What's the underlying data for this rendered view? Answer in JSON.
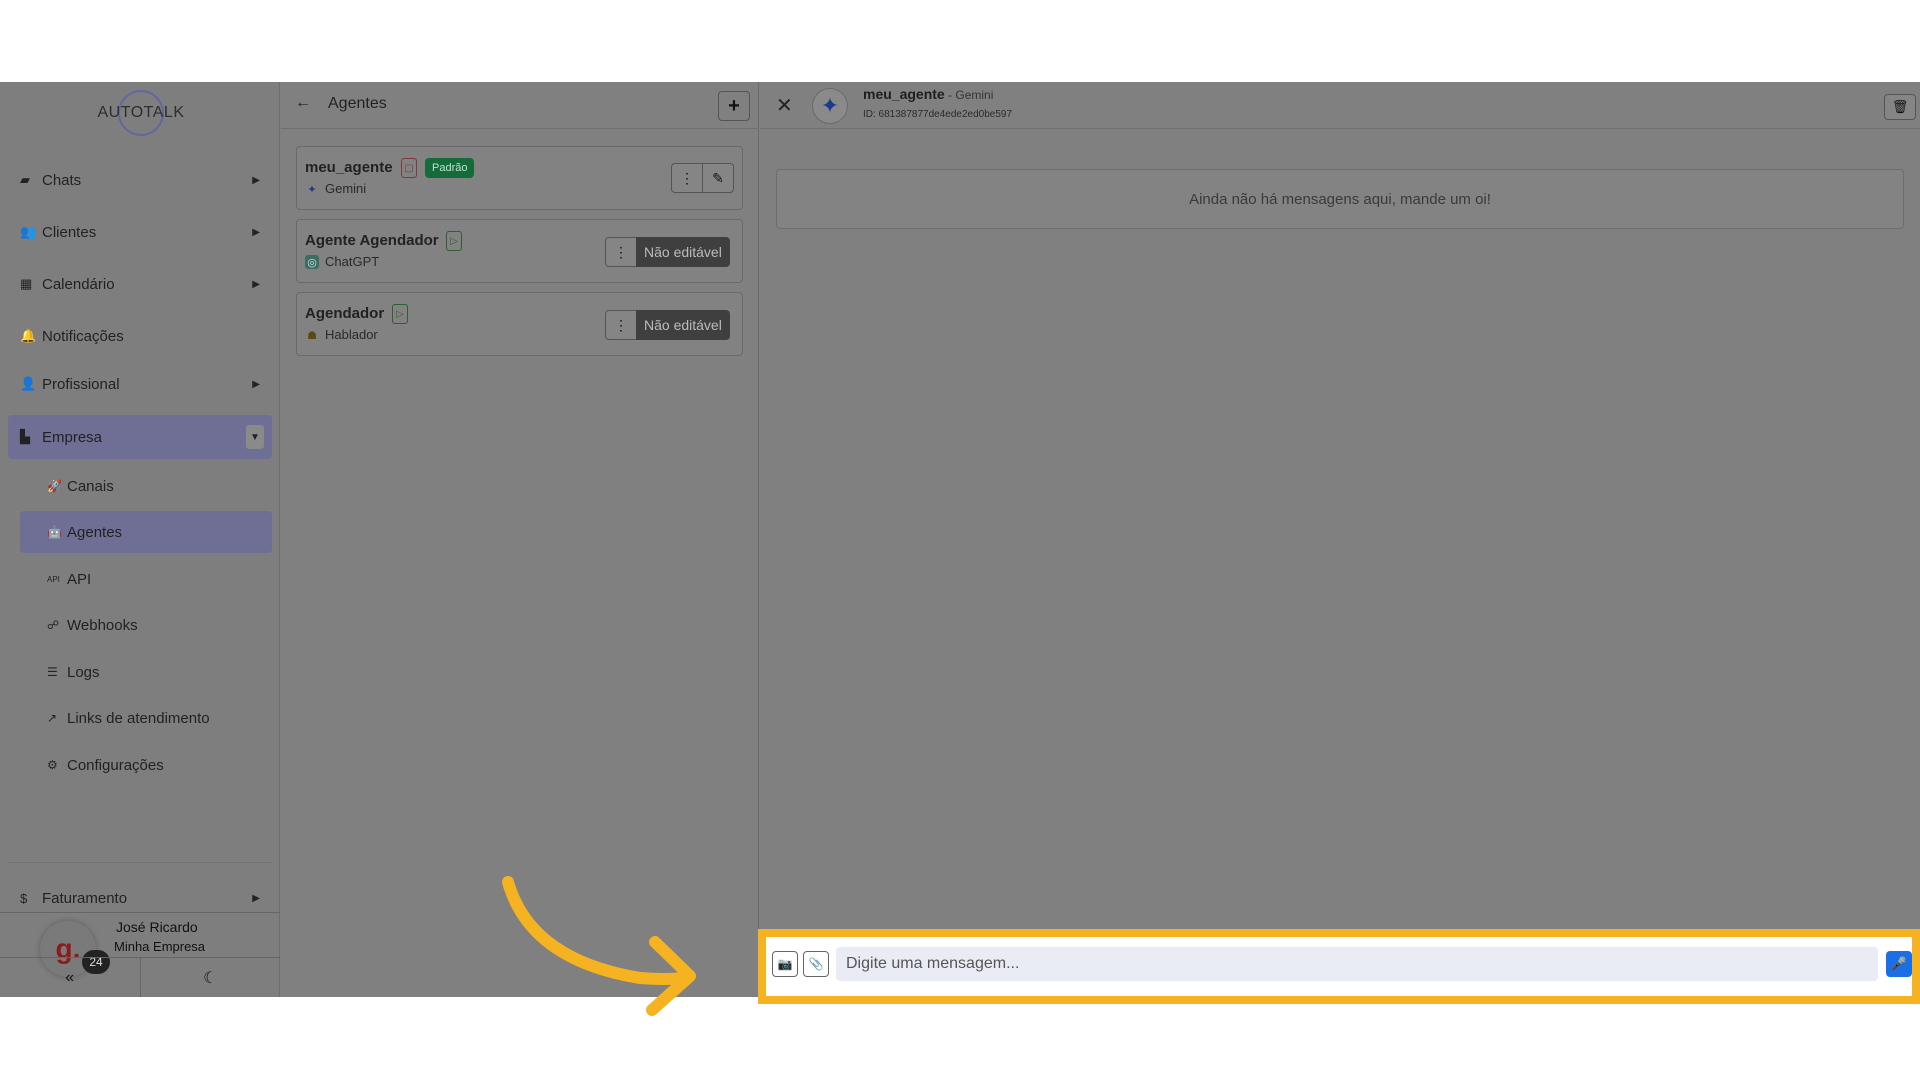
{
  "brand": {
    "logo_text": "AUTOTALK"
  },
  "sidebar": {
    "items": [
      {
        "label": "Chats",
        "icon": "chat-icon"
      },
      {
        "label": "Clientes",
        "icon": "users-icon"
      },
      {
        "label": "Calendário",
        "icon": "calendar-icon"
      },
      {
        "label": "Notificações",
        "icon": "bell-icon"
      },
      {
        "label": "Profissional",
        "icon": "user-gear-icon"
      },
      {
        "label": "Empresa",
        "icon": "building-icon"
      },
      {
        "label": "Faturamento",
        "icon": "dollar-icon"
      }
    ],
    "sub_items": [
      {
        "label": "Canais",
        "icon": "rocket-icon"
      },
      {
        "label": "Agentes",
        "icon": "robot-icon"
      },
      {
        "label": "API",
        "icon": "api-icon"
      },
      {
        "label": "Webhooks",
        "icon": "webhook-icon"
      },
      {
        "label": "Logs",
        "icon": "list-icon"
      },
      {
        "label": "Links de atendimento",
        "icon": "external-link-icon"
      },
      {
        "label": "Configurações",
        "icon": "gear-icon"
      }
    ],
    "user": {
      "name": "José Ricardo",
      "company": "Minha Empresa",
      "badge": "24",
      "avatar_letter": "g."
    },
    "collapse_glyph": "«",
    "theme_glyph": "☾"
  },
  "agents_panel": {
    "title": "Agentes",
    "back_glyph": "←",
    "add_glyph": "+",
    "agents": [
      {
        "name": "meu_agente",
        "provider": "Gemini",
        "badge": "Padrão"
      },
      {
        "name": "Agente Agendador",
        "provider": "ChatGPT",
        "action": "Não editável"
      },
      {
        "name": "Agendador",
        "provider": "Hablador",
        "action": "Não editável"
      }
    ]
  },
  "chat": {
    "agent_name": "meu_agente",
    "agent_provider": " - Gemini",
    "agent_id": "ID: 681387877de4ede2ed0be597",
    "empty_message": "Ainda não há mensagens aqui, mande um oi!",
    "input_placeholder": "Digite uma mensagem...",
    "close_glyph": "✕"
  },
  "colors": {
    "highlight": "#f5b321",
    "accent_blue": "#1a6ee6",
    "badge_green": "#166b3a"
  }
}
